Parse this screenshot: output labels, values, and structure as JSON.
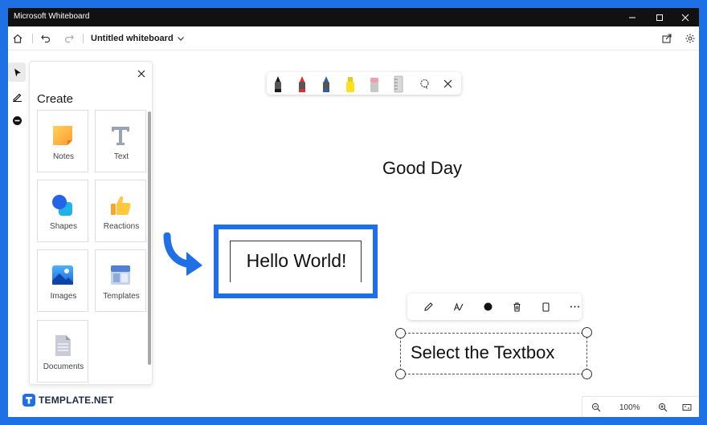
{
  "window": {
    "title": "Microsoft Whiteboard"
  },
  "menubar": {
    "document_title": "Untitled whiteboard"
  },
  "create_panel": {
    "heading": "Create",
    "tiles": [
      {
        "label": "Notes",
        "icon": "sticky-note-icon"
      },
      {
        "label": "Text",
        "icon": "text-icon"
      },
      {
        "label": "Shapes",
        "icon": "shapes-icon"
      },
      {
        "label": "Reactions",
        "icon": "thumbs-up-icon"
      },
      {
        "label": "Images",
        "icon": "image-icon"
      },
      {
        "label": "Templates",
        "icon": "templates-icon"
      },
      {
        "label": "Documents",
        "icon": "document-icon"
      }
    ]
  },
  "pen_toolbar": {
    "pens": [
      {
        "name": "black-pen",
        "color": "#1a1a1a"
      },
      {
        "name": "red-pen",
        "color": "#e52b2b"
      },
      {
        "name": "blue-pen",
        "color": "#2d5fae"
      },
      {
        "name": "highlighter",
        "color": "#ffe11b"
      },
      {
        "name": "eraser",
        "color": "#f0a0aa"
      },
      {
        "name": "ruler",
        "color": "#c9c9c9"
      }
    ]
  },
  "canvas": {
    "greeting": "Good Day",
    "hello_text": "Hello World!",
    "selected_text": "Select the Textbox"
  },
  "zoom": {
    "level": "100%"
  },
  "watermark": {
    "brand": "TEMPLATE.NET"
  },
  "colors": {
    "accent": "#1f6fe5",
    "titlebar": "#111111"
  }
}
